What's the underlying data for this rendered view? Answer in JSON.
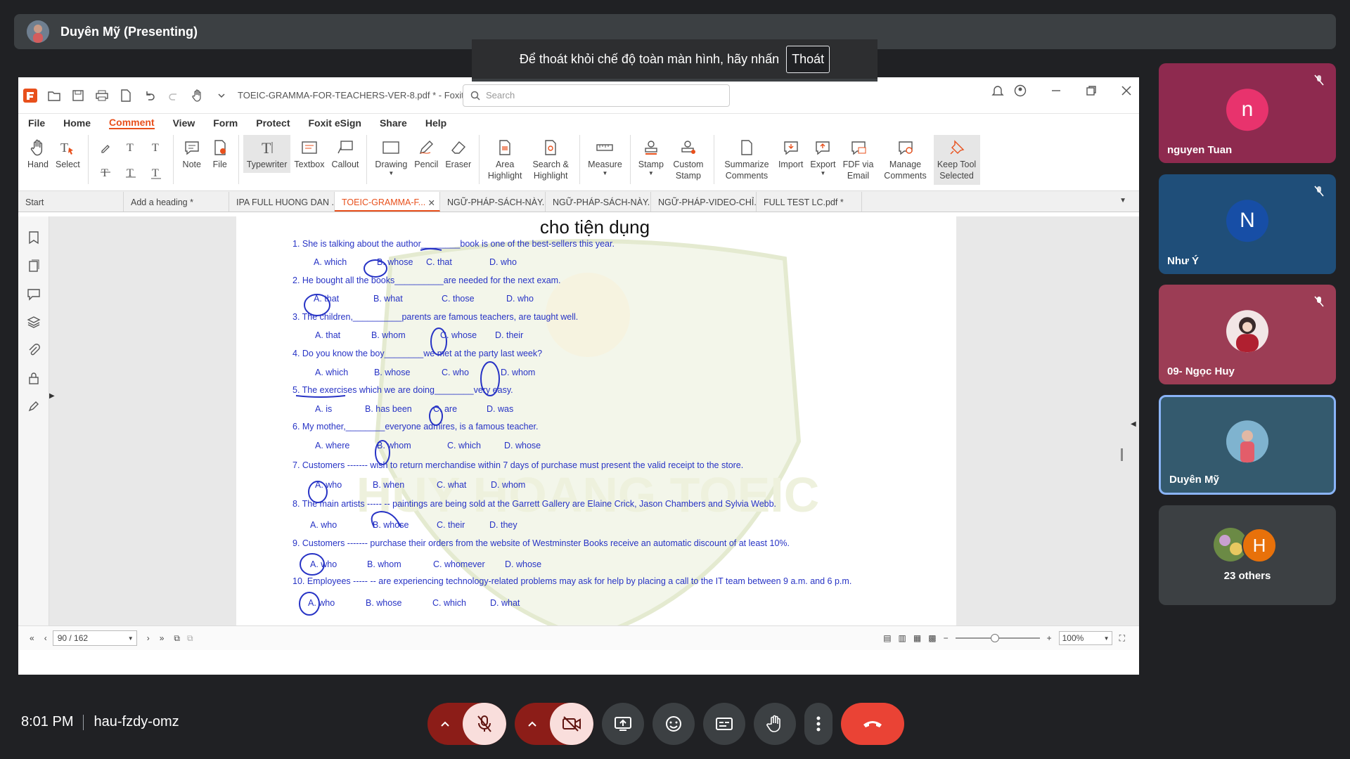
{
  "presenter": {
    "name": "Duyên Mỹ (Presenting)"
  },
  "fullscreen_notice": {
    "text": "Để thoát khỏi chế độ toàn màn hình, hãy nhấn",
    "button": "Thoát"
  },
  "app": {
    "doc_title": "TOEIC-GRAMMA-FOR-TEACHERS-VER-8.pdf * - Foxit ...",
    "search_placeholder": "Search",
    "menu": [
      "File",
      "Home",
      "Comment",
      "View",
      "Form",
      "Protect",
      "Foxit eSign",
      "Share",
      "Help"
    ],
    "active_menu": "Comment",
    "ribbon": {
      "hand": "Hand",
      "select": "Select",
      "note": "Note",
      "file": "File",
      "typewriter": "Typewriter",
      "textbox": "Textbox",
      "callout": "Callout",
      "drawing": "Drawing",
      "pencil": "Pencil",
      "eraser": "Eraser",
      "area_highlight": "Area Highlight",
      "search_highlight": "Search & Highlight",
      "measure": "Measure",
      "stamp": "Stamp",
      "custom_stamp": "Custom Stamp",
      "summarize": "Summarize Comments",
      "import": "Import",
      "export": "Export",
      "fdf": "FDF via Email",
      "manage": "Manage Comments",
      "keep_tool": "Keep Tool Selected"
    },
    "tabs": [
      "Start",
      "Add a heading *",
      "IPA FULL HUONG DAN ...",
      "TOEIC-GRAMMA-F...",
      "NGỮ-PHÁP-SÁCH-NÀY...",
      "NGỮ-PHÁP-SÁCH-NÀY...",
      "NGỮ-PHÁP-VIDEO-CHỈ...",
      "FULL TEST  LC.pdf *"
    ],
    "page_heading": "cho tiện dụng",
    "watermark": "HUY HOANG TOEIC",
    "questions": [
      {
        "q": "1. She is talking about the author________book is one of the best-sellers this year.",
        "opts": [
          "A. which",
          "B. whose",
          "C. that",
          "D. who"
        ]
      },
      {
        "q": "2. He bought all the books__________are needed for the next exam.",
        "opts": [
          "A. that",
          "B. what",
          "C. those",
          "D. who"
        ]
      },
      {
        "q": "3. The children,__________parents are famous teachers, are taught well.",
        "opts": [
          "A. that",
          "B. whom",
          "C. whose",
          "D. their"
        ]
      },
      {
        "q": "4. Do you know the boy________we met at the party last week?",
        "opts": [
          "A. which",
          "B. whose",
          "C. who",
          "D. whom"
        ]
      },
      {
        "q": "5. The exercises which we are doing________very easy.",
        "opts": [
          "A. is",
          "B. has been",
          "C. are",
          "D. was"
        ]
      },
      {
        "q": "6. My mother,________everyone admires, is a famous teacher.",
        "opts": [
          "A. where",
          "B. whom",
          "C. which",
          "D. whose"
        ]
      },
      {
        "q": "7. Customers ------- wish to return merchandise within 7 days of purchase must present the valid receipt to the store.",
        "opts": [
          "A. who",
          "B. when",
          "C. what",
          "D. whom"
        ]
      },
      {
        "q": "8. The main artists ----- -- paintings are being sold at the Garrett Gallery are Elaine Crick, Jason Chambers and Sylvia Webb.",
        "opts": [
          "A. who",
          "B. whose",
          "C. their",
          "D. they"
        ]
      },
      {
        "q": "9.  Customers ------- purchase their orders from the website of Westminster Books receive an automatic discount of at least 10%.",
        "opts": [
          "A. who",
          "B. whom",
          "C. whomever",
          "D. whose"
        ]
      },
      {
        "q": "10. Employees ----- -- are experiencing technology-related problems may ask for help by placing a call to the IT team between 9 a.m. and 6 p.m.",
        "opts": [
          "A. who",
          "B. whose",
          "C. which",
          "D. what"
        ]
      }
    ],
    "page_indicator": "90 / 162",
    "zoom": "100%"
  },
  "participants": [
    {
      "name": "nguyen Tuan",
      "initial": "n",
      "color": "#e8336d",
      "bg": "#8e2a4f",
      "muted": true
    },
    {
      "name": "Như Ý",
      "initial": "N",
      "color": "#174ea6",
      "bg": "#1f4e79",
      "muted": true
    },
    {
      "name": "09- Ngọc Huy",
      "initial": "",
      "color": "#a04050",
      "bg": "#9c3d55",
      "muted": true
    },
    {
      "name": "Duyên Mỹ",
      "initial": "",
      "color": "#6a8fa5",
      "bg": "#345a6e",
      "muted": false
    },
    {
      "name": "23 others",
      "initial": "H",
      "color": "#e8710a",
      "bg": "#3c4043",
      "muted": false
    }
  ],
  "meeting": {
    "time": "8:01 PM",
    "code": "hau-fzdy-omz"
  },
  "colors": {
    "accent": "#e8501c",
    "annotation": "#2733c5",
    "end_call": "#ea4335"
  }
}
